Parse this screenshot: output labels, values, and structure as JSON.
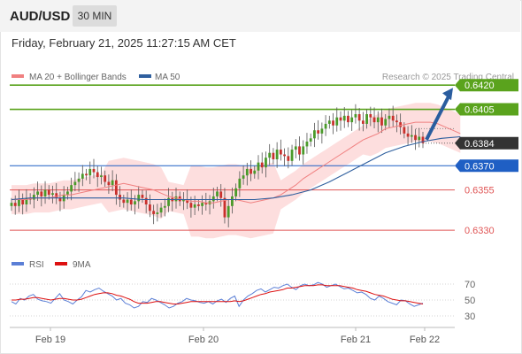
{
  "header": {
    "symbol": "AUD/USD",
    "timeframe": "30 MIN"
  },
  "datetime": "Friday, February 21, 2025 11:27:15 AM CET",
  "colors": {
    "resistance": "#5aa31d",
    "support_blue": "#1f5fc4",
    "support_red": "#e05555",
    "last_price": "#333333",
    "up_candle": "#4a9a2a",
    "down_candle": "#c9302c",
    "bollinger_fill": "#fcd6d6",
    "ma20": "#f08080",
    "ma50": "#2f5f9e",
    "rsi": "#5b7fd6",
    "rsi_ma": "#dd1111",
    "arrow": "#2a5d9f"
  },
  "chart_data": [
    {
      "type": "candlestick",
      "title": "",
      "legend": [
        "MA 20 + Bollinger Bands",
        "MA 50"
      ],
      "legend_position": "top-left",
      "watermark": "Research © 2025 Trading Central",
      "x_ticks": [
        "Feb 19",
        "Feb 20",
        "Feb 21",
        "Feb 22"
      ],
      "ylim": [
        0.6318,
        0.643
      ],
      "levels": [
        {
          "value": 0.642,
          "label": "0.6420",
          "role": "resistance"
        },
        {
          "value": 0.6405,
          "label": "0.6405",
          "role": "resistance"
        },
        {
          "value": 0.6384,
          "label": "0.6384",
          "role": "last_price"
        },
        {
          "value": 0.637,
          "label": "0.6370",
          "role": "pivot"
        },
        {
          "value": 0.6355,
          "label": "0.6355",
          "role": "support"
        },
        {
          "value": 0.633,
          "label": "0.6330",
          "role": "support"
        }
      ],
      "close": [
        0.6347,
        0.6345,
        0.6349,
        0.6346,
        0.635,
        0.6349,
        0.6352,
        0.6354,
        0.6351,
        0.6355,
        0.6352,
        0.6353,
        0.635,
        0.6348,
        0.6352,
        0.6354,
        0.6358,
        0.636,
        0.6362,
        0.6365,
        0.6364,
        0.6368,
        0.6366,
        0.6363,
        0.6364,
        0.636,
        0.6358,
        0.6361,
        0.6352,
        0.6349,
        0.6347,
        0.6349,
        0.6346,
        0.6348,
        0.6352,
        0.635,
        0.6346,
        0.6342,
        0.634,
        0.6341,
        0.6344,
        0.6345,
        0.635,
        0.6348,
        0.6351,
        0.6348,
        0.6349,
        0.6347,
        0.6344,
        0.6346,
        0.6345,
        0.6347,
        0.6346,
        0.6348,
        0.6351,
        0.6354,
        0.635,
        0.6338,
        0.6345,
        0.6351,
        0.6356,
        0.6362,
        0.6364,
        0.6368,
        0.6365,
        0.6367,
        0.6372,
        0.6369,
        0.6375,
        0.6378,
        0.6374,
        0.638,
        0.6377,
        0.6376,
        0.6373,
        0.638,
        0.6382,
        0.6377,
        0.6382,
        0.6385,
        0.6387,
        0.6392,
        0.639,
        0.6393,
        0.6396,
        0.6398,
        0.6395,
        0.64,
        0.6398,
        0.6401,
        0.6397,
        0.64,
        0.6402,
        0.6398,
        0.6396,
        0.6402,
        0.64,
        0.6397,
        0.64,
        0.6395,
        0.6399,
        0.6401,
        0.6398,
        0.6397,
        0.6394,
        0.639,
        0.6388,
        0.6389,
        0.6386,
        0.6388,
        0.6384
      ],
      "ma20": [
        0.6349,
        0.6349,
        0.6349,
        0.635,
        0.635,
        0.635,
        0.6351,
        0.6352,
        0.6352,
        0.6353,
        0.6354,
        0.6355,
        0.6356,
        0.6357,
        0.6358,
        0.6359,
        0.6358,
        0.6357,
        0.6356,
        0.6355,
        0.6353,
        0.6351,
        0.635,
        0.6349,
        0.6348,
        0.6348,
        0.6347,
        0.6347,
        0.6348,
        0.6349,
        0.6349,
        0.6348,
        0.6347,
        0.6348,
        0.6349,
        0.635,
        0.6352,
        0.6355,
        0.6358,
        0.6362,
        0.6365,
        0.6368,
        0.6371,
        0.6374,
        0.6377,
        0.638,
        0.6383,
        0.6386,
        0.6388,
        0.639,
        0.6393,
        0.6394,
        0.6395,
        0.6396,
        0.6397,
        0.6397,
        0.6397,
        0.6396,
        0.6394,
        0.6392,
        0.639
      ],
      "ma20_x": [
        0,
        2,
        4,
        6,
        8,
        10,
        12,
        14,
        16,
        18,
        20,
        22,
        24,
        26,
        28,
        30,
        32,
        34,
        36,
        38,
        40,
        42,
        44,
        46,
        48,
        50,
        52,
        54,
        56,
        58,
        60,
        62,
        64,
        66,
        68,
        70,
        72,
        74,
        76,
        78,
        80,
        82,
        84,
        86,
        88,
        90,
        92,
        94,
        96,
        98,
        100,
        102,
        104,
        106,
        108,
        110,
        112,
        114,
        116,
        118,
        120
      ],
      "ma50": [
        0.6349,
        0.635,
        0.635,
        0.635,
        0.635,
        0.635,
        0.635,
        0.6349,
        0.6349,
        0.6349,
        0.6349,
        0.6349,
        0.6349,
        0.6349,
        0.635,
        0.6352,
        0.6355,
        0.636,
        0.6366,
        0.6372,
        0.6378,
        0.6382,
        0.6385,
        0.6387,
        0.6388
      ],
      "ma50_x": [
        0,
        5,
        10,
        15,
        20,
        25,
        30,
        35,
        40,
        45,
        50,
        55,
        60,
        65,
        70,
        75,
        80,
        85,
        90,
        95,
        100,
        105,
        110,
        115,
        120
      ]
    },
    {
      "type": "line",
      "title": "",
      "legend": [
        "RSI",
        "9MA"
      ],
      "legend_position": "top-left",
      "y_ticks": [
        70,
        50,
        30
      ],
      "ylim": [
        20,
        80
      ],
      "rsi": [
        48,
        45,
        52,
        50,
        55,
        57,
        51,
        49,
        48,
        46,
        52,
        58,
        50,
        48,
        45,
        50,
        54,
        62,
        60,
        63,
        65,
        61,
        58,
        55,
        50,
        52,
        46,
        44,
        40,
        42,
        48,
        47,
        52,
        50,
        47,
        44,
        40,
        42,
        46,
        48,
        52,
        50,
        49,
        47,
        46,
        48,
        45,
        49,
        51,
        47,
        52,
        55,
        42,
        50,
        55,
        58,
        62,
        64,
        60,
        63,
        66,
        65,
        68,
        70,
        66,
        63,
        68,
        70,
        68,
        69,
        72,
        70,
        66,
        68,
        70,
        67,
        64,
        65,
        62,
        59,
        60,
        57,
        52,
        50,
        55,
        52,
        48,
        46,
        44,
        50,
        49,
        45,
        42,
        44,
        46
      ],
      "rsi_ma": [
        50,
        50,
        51,
        51,
        52,
        53,
        53,
        52,
        51,
        50,
        51,
        52,
        52,
        51,
        50,
        50,
        51,
        53,
        55,
        57,
        58,
        59,
        59,
        58,
        56,
        55,
        53,
        51,
        48,
        46,
        46,
        46,
        47,
        48,
        48,
        47,
        46,
        45,
        45,
        46,
        47,
        48,
        48,
        48,
        48,
        48,
        48,
        48,
        48,
        48,
        48,
        49,
        48,
        49,
        51,
        53,
        55,
        57,
        58,
        60,
        61,
        62,
        63,
        65,
        65,
        66,
        67,
        68,
        68,
        68,
        69,
        69,
        68,
        68,
        68,
        68,
        67,
        66,
        65,
        63,
        62,
        61,
        59,
        57,
        56,
        55,
        53,
        51,
        50,
        49,
        49,
        48,
        47,
        46,
        45
      ]
    }
  ],
  "annotations": {
    "arrow_to": "0.6420"
  }
}
